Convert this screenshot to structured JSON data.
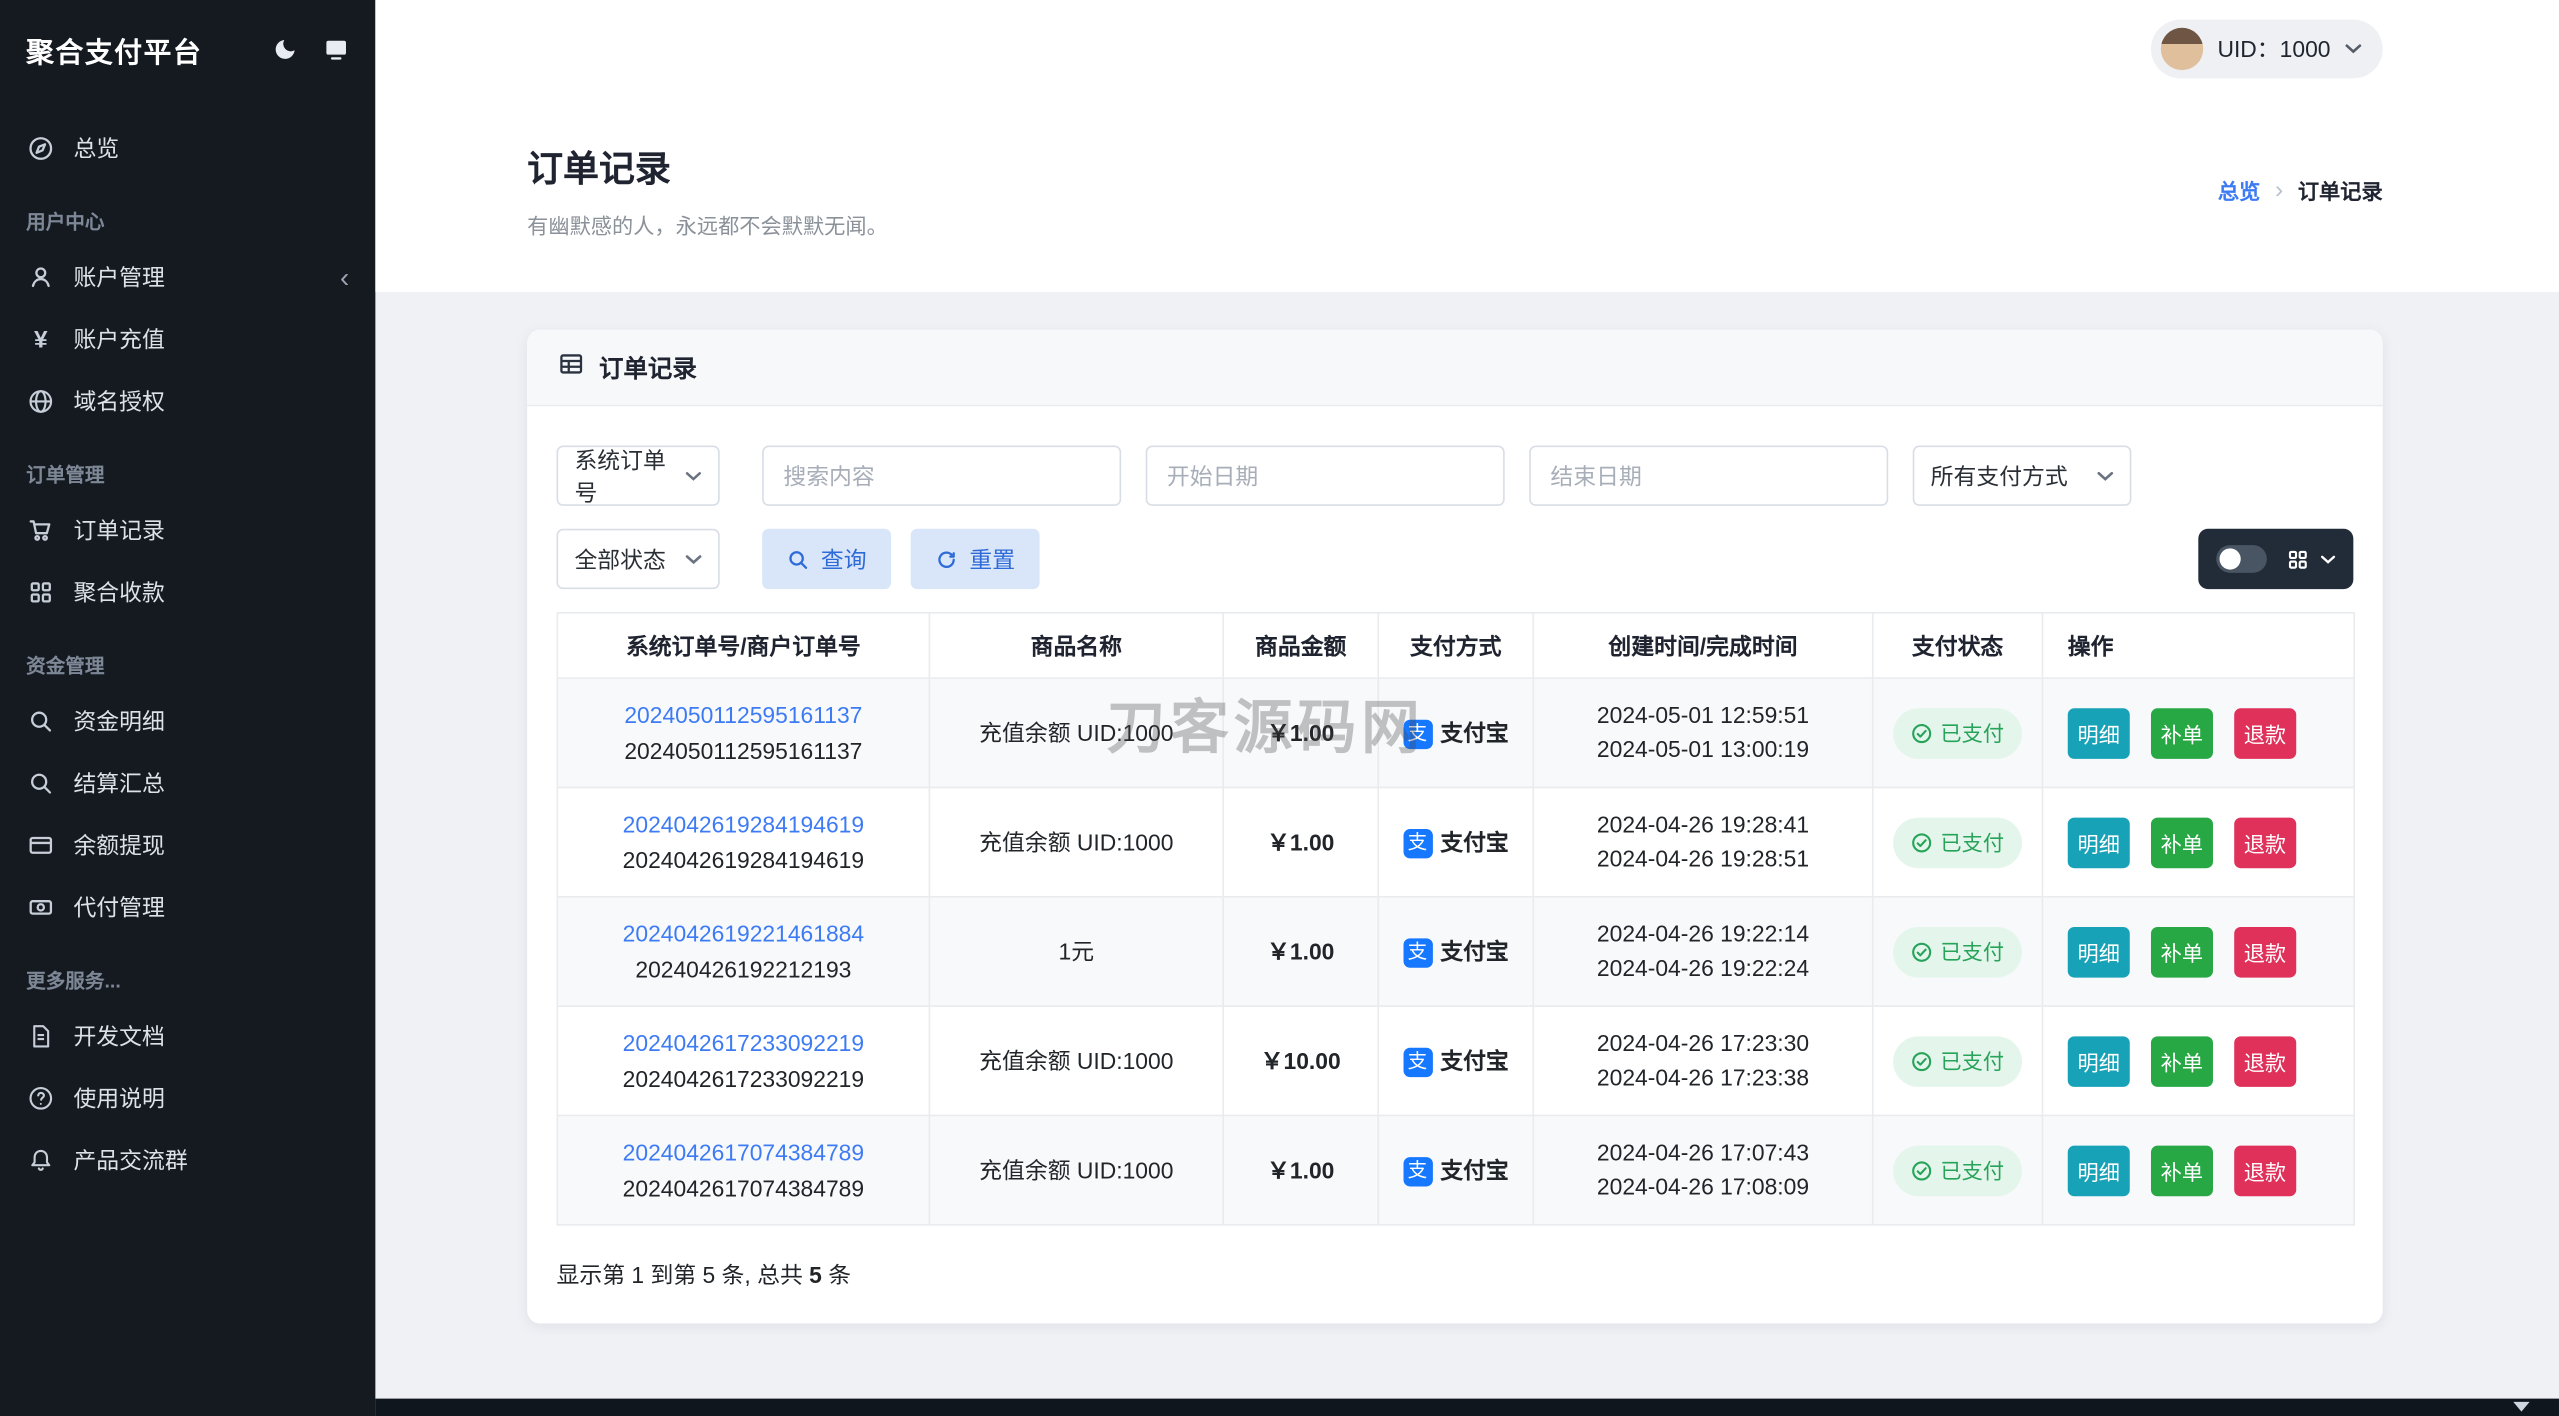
{
  "colors": {
    "sidebar_bg": "#151a21",
    "accent_blue": "#3d7bf5",
    "alipay_blue": "#1677ff",
    "success_green": "#28a745",
    "info_teal": "#17a2b8",
    "danger_red": "#e0315b",
    "badge_green_bg": "#e4f6eb",
    "soft_button_bg": "#d9e6f9",
    "soft_button_text": "#2f6bd8"
  },
  "sidebar": {
    "logo": "聚合支付平台",
    "header_icons": [
      "moon-icon",
      "screen-icon"
    ],
    "groups": [
      {
        "title": "",
        "items": [
          {
            "label": "总览",
            "icon": "compass-icon"
          }
        ]
      },
      {
        "title": "用户中心",
        "items": [
          {
            "label": "账户管理",
            "icon": "user-icon",
            "chevron": "‹"
          },
          {
            "label": "账户充值",
            "icon": "yen-icon"
          },
          {
            "label": "域名授权",
            "icon": "globe-icon"
          }
        ]
      },
      {
        "title": "订单管理",
        "items": [
          {
            "label": "订单记录",
            "icon": "cart-icon"
          },
          {
            "label": "聚合收款",
            "icon": "grid-icon"
          }
        ]
      },
      {
        "title": "资金管理",
        "items": [
          {
            "label": "资金明细",
            "icon": "search-icon"
          },
          {
            "label": "结算汇总",
            "icon": "search-icon"
          },
          {
            "label": "余额提现",
            "icon": "card-icon"
          },
          {
            "label": "代付管理",
            "icon": "banknote-icon"
          }
        ]
      },
      {
        "title": "更多服务...",
        "items": [
          {
            "label": "开发文档",
            "icon": "document-icon"
          },
          {
            "label": "使用说明",
            "icon": "help-icon"
          },
          {
            "label": "产品交流群",
            "icon": "bell-icon"
          }
        ]
      }
    ]
  },
  "topbar": {
    "uid": "UID：1000"
  },
  "header": {
    "title": "订单记录",
    "subtitle": "有幽默感的人，永远都不会默默无闻。",
    "breadcrumb": {
      "home": "总览",
      "separator": "›",
      "current": "订单记录"
    }
  },
  "card": {
    "title": "订单记录"
  },
  "filters": {
    "order_type": "系统订单号",
    "search_placeholder": "搜索内容",
    "start_date_placeholder": "开始日期",
    "end_date_placeholder": "结束日期",
    "pay_method": "所有支付方式",
    "status": "全部状态",
    "query_label": "查询",
    "reset_label": "重置"
  },
  "table": {
    "columns": [
      "系统订单号/商户订单号",
      "商品名称",
      "商品金额",
      "支付方式",
      "创建时间/完成时间",
      "支付状态",
      "操作"
    ],
    "actions": [
      "明细",
      "补单",
      "退款"
    ],
    "alipay_glyph": "支",
    "rows": [
      {
        "order_no": "2024050112595161137",
        "merchant_no": "2024050112595161137",
        "product": "充值余额 UID:1000",
        "amount": "￥1.00",
        "pay": "支付宝",
        "created": "2024-05-01 12:59:51",
        "finished": "2024-05-01 13:00:19",
        "status": "已支付"
      },
      {
        "order_no": "2024042619284194619",
        "merchant_no": "2024042619284194619",
        "product": "充值余额 UID:1000",
        "amount": "￥1.00",
        "pay": "支付宝",
        "created": "2024-04-26 19:28:41",
        "finished": "2024-04-26 19:28:51",
        "status": "已支付"
      },
      {
        "order_no": "2024042619221461884",
        "merchant_no": "20240426192212193",
        "product": "1元",
        "amount": "￥1.00",
        "pay": "支付宝",
        "created": "2024-04-26 19:22:14",
        "finished": "2024-04-26 19:22:24",
        "status": "已支付"
      },
      {
        "order_no": "2024042617233092219",
        "merchant_no": "2024042617233092219",
        "product": "充值余额 UID:1000",
        "amount": "￥10.00",
        "pay": "支付宝",
        "created": "2024-04-26 17:23:30",
        "finished": "2024-04-26 17:23:38",
        "status": "已支付"
      },
      {
        "order_no": "2024042617074384789",
        "merchant_no": "2024042617074384789",
        "product": "充值余额 UID:1000",
        "amount": "￥1.00",
        "pay": "支付宝",
        "created": "2024-04-26 17:07:43",
        "finished": "2024-04-26 17:08:09",
        "status": "已支付"
      }
    ],
    "summary": {
      "prefix": "显示第 1 到第 5 条, 总共 ",
      "total": "5",
      "suffix": " 条"
    }
  },
  "watermark": "刀客源码网"
}
